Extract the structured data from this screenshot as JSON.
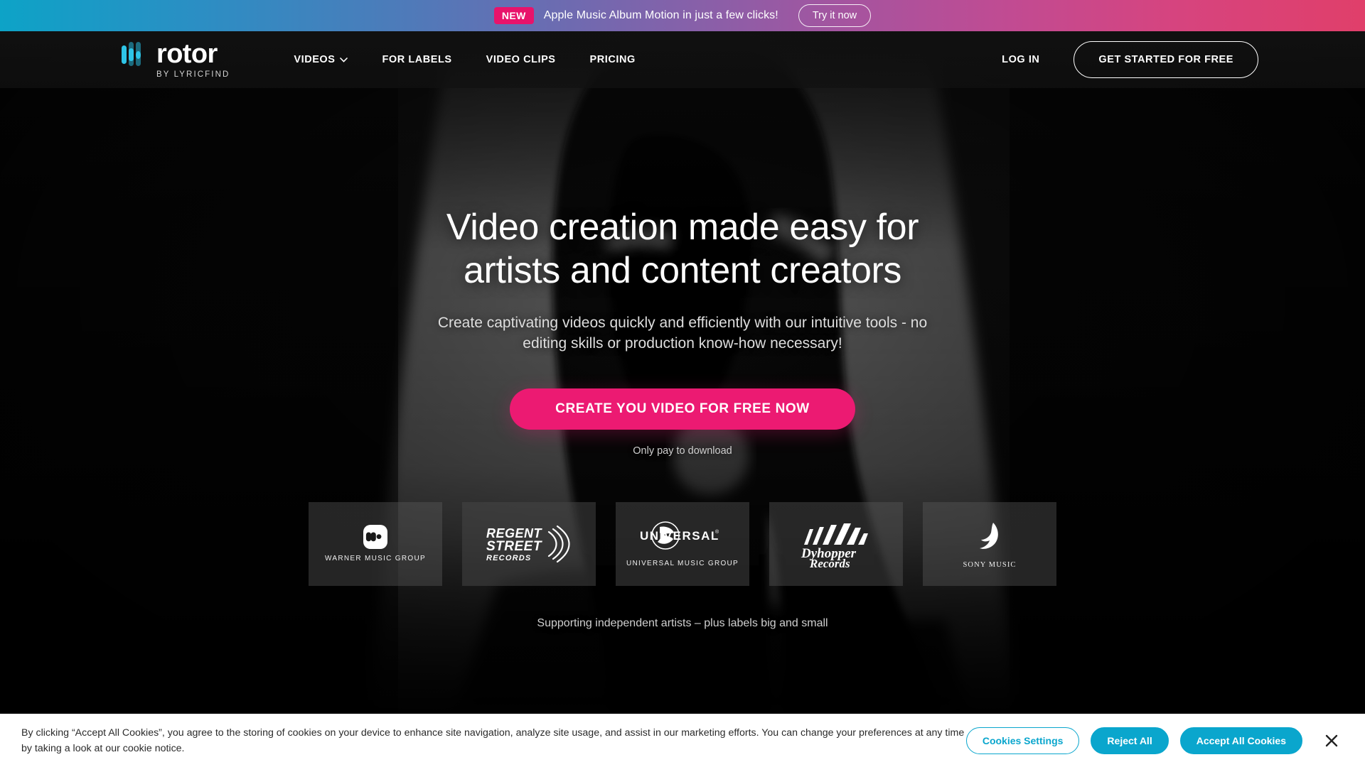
{
  "promo": {
    "badge": "NEW",
    "message": "Apple Music Album Motion in just a few clicks!",
    "cta_label": "Try it now",
    "badge_color": "#e8136b"
  },
  "nav": {
    "brand": {
      "name": "rotor",
      "tagline": "BY LYRICFIND",
      "mark_color": "#2ec4e6"
    },
    "links": [
      {
        "label": "VIDEOS",
        "has_dropdown": true,
        "icon": "chevron-down-icon"
      },
      {
        "label": "FOR LABELS",
        "has_dropdown": false
      },
      {
        "label": "VIDEO CLIPS",
        "has_dropdown": false
      },
      {
        "label": "PRICING",
        "has_dropdown": false
      }
    ],
    "login_label": "LOG IN",
    "get_started_label": "GET STARTED FOR FREE"
  },
  "hero": {
    "headline": "Video creation made easy for artists and content creators",
    "subhead": "Create captivating videos quickly and efficiently with our intuitive tools - no editing skills or production know-how necessary!",
    "cta_label": "CREATE YOU VIDEO FOR FREE NOW",
    "cta_color": "#ec1a72",
    "cta_note": "Only pay to download"
  },
  "partners": {
    "note": "Supporting independent artists – plus labels big and small",
    "logos": [
      {
        "name": "warner-music-group-logo",
        "caption": "WARNER MUSIC GROUP",
        "mark": "warner-w-icon"
      },
      {
        "name": "regent-street-records-logo",
        "caption": "",
        "mark": "regent-street-records-icon"
      },
      {
        "name": "universal-music-group-logo",
        "caption": "UNIVERSAL MUSIC GROUP",
        "mark": "universal-globe-icon"
      },
      {
        "name": "dyhopper-records-logo",
        "caption": "",
        "mark": "dyhopper-records-icon"
      },
      {
        "name": "sony-music-logo",
        "caption": "SONY MUSIC",
        "mark": "sony-music-swoosh-icon"
      }
    ]
  },
  "cookie": {
    "text": "By clicking “Accept All Cookies”, you agree to the storing of cookies on your device to enhance site navigation, analyze site usage, and assist in our marketing efforts. You can change your preferences at any time by taking a look at our cookie notice.",
    "settings_label": "Cookies Settings",
    "reject_label": "Reject All",
    "accept_label": "Accept All Cookies",
    "close_icon": "close-icon",
    "accent_color": "#0aa6cd"
  }
}
